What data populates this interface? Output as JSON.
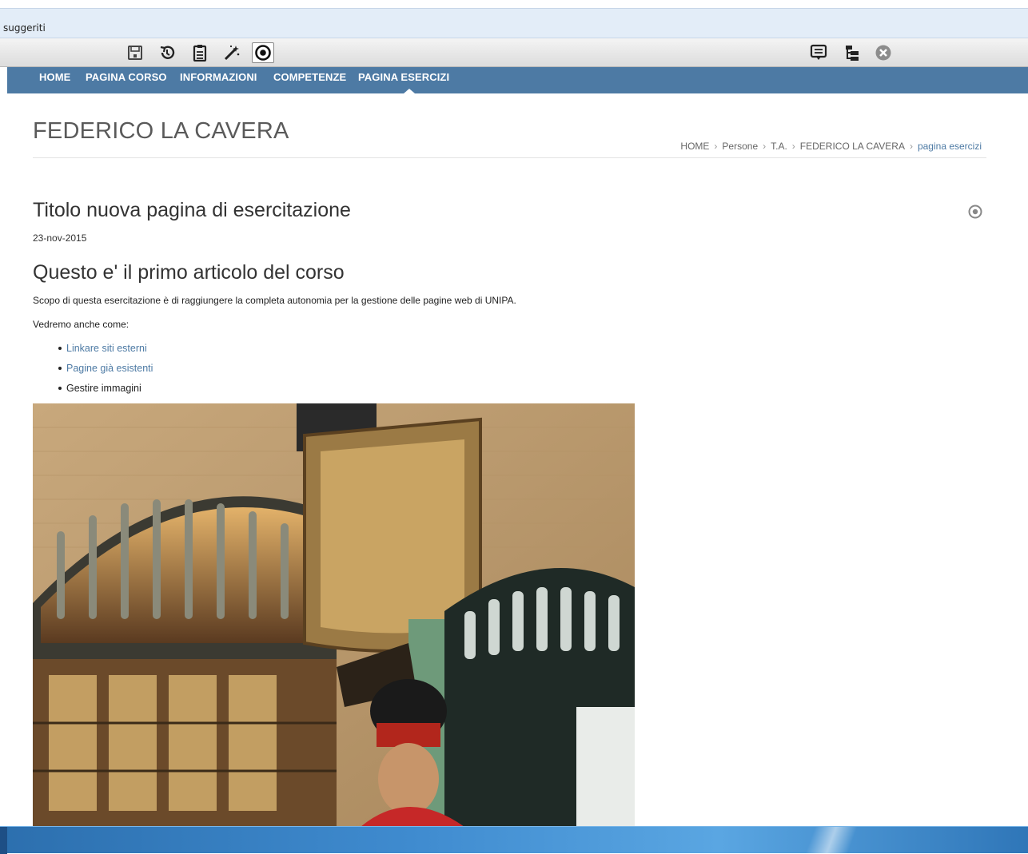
{
  "browser": {
    "suggestions_label": "suggeriti"
  },
  "editor_toolbar": {
    "left_icons": [
      "save-icon",
      "history-icon",
      "clipboard-icon",
      "magic-wand-icon",
      "target-icon"
    ],
    "right_icons": [
      "comment-icon",
      "tree-icon",
      "close-circle-icon"
    ]
  },
  "nav": {
    "items": [
      {
        "label": "HOME"
      },
      {
        "label": "PAGINA CORSO"
      },
      {
        "label": "INFORMAZIONI"
      },
      {
        "label": "COMPETENZE"
      },
      {
        "label": "PAGINA ESERCIZI"
      }
    ],
    "active": "PAGINA ESERCIZI"
  },
  "header": {
    "title": "FEDERICO LA CAVERA",
    "breadcrumb": [
      "HOME",
      "Persone",
      "T.A.",
      "FEDERICO LA CAVERA",
      "pagina esercizi"
    ]
  },
  "article": {
    "title": "Titolo nuova pagina di esercitazione",
    "date": "23-nov-2015",
    "subtitle": "Questo e' il primo articolo del corso",
    "paragraph1": "Scopo di questa esercitazione è di raggiungere la completa autonomia per la gestione delle pagine web di UNIPA.",
    "paragraph2": "Vedremo anche come:",
    "list": [
      {
        "text": "Linkare siti esterni",
        "link": true
      },
      {
        "text": "Pagine già esistenti",
        "link": true
      },
      {
        "text": "Gestire immagini",
        "link": false
      }
    ]
  },
  "colors": {
    "nav_bg": "#4d7aa4",
    "link": "#4d7aa4",
    "suggest_bg": "#e3edf8"
  }
}
